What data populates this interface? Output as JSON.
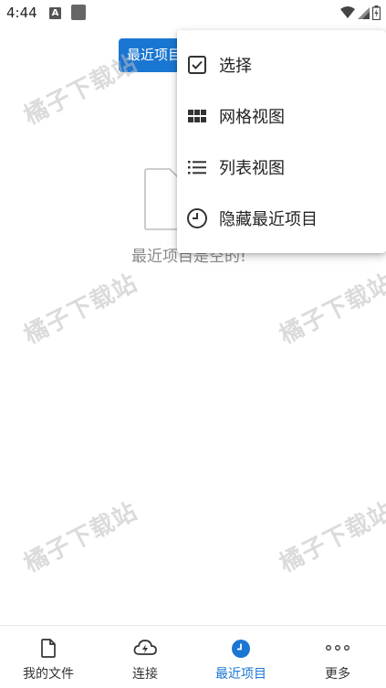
{
  "status_bar": {
    "time": "4:44",
    "notif_icon_a": "A"
  },
  "chip": {
    "label": "最近项目"
  },
  "empty_state": {
    "text": "最近项目是空的!"
  },
  "menu": {
    "items": [
      {
        "label": "选择",
        "icon": "checkbox-icon"
      },
      {
        "label": "网格视图",
        "icon": "grid-icon"
      },
      {
        "label": "列表视图",
        "icon": "list-icon"
      },
      {
        "label": "隐藏最近项目",
        "icon": "clock-icon"
      }
    ]
  },
  "watermark": "橘子下载站",
  "bottom_nav": {
    "items": [
      {
        "label": "我的文件",
        "icon": "file-icon"
      },
      {
        "label": "连接",
        "icon": "cloud-icon"
      },
      {
        "label": "最近项目",
        "icon": "recent-clock-icon",
        "active": true
      },
      {
        "label": "更多",
        "icon": "more-dots-icon"
      }
    ]
  },
  "colors": {
    "accent": "#1976d2"
  }
}
